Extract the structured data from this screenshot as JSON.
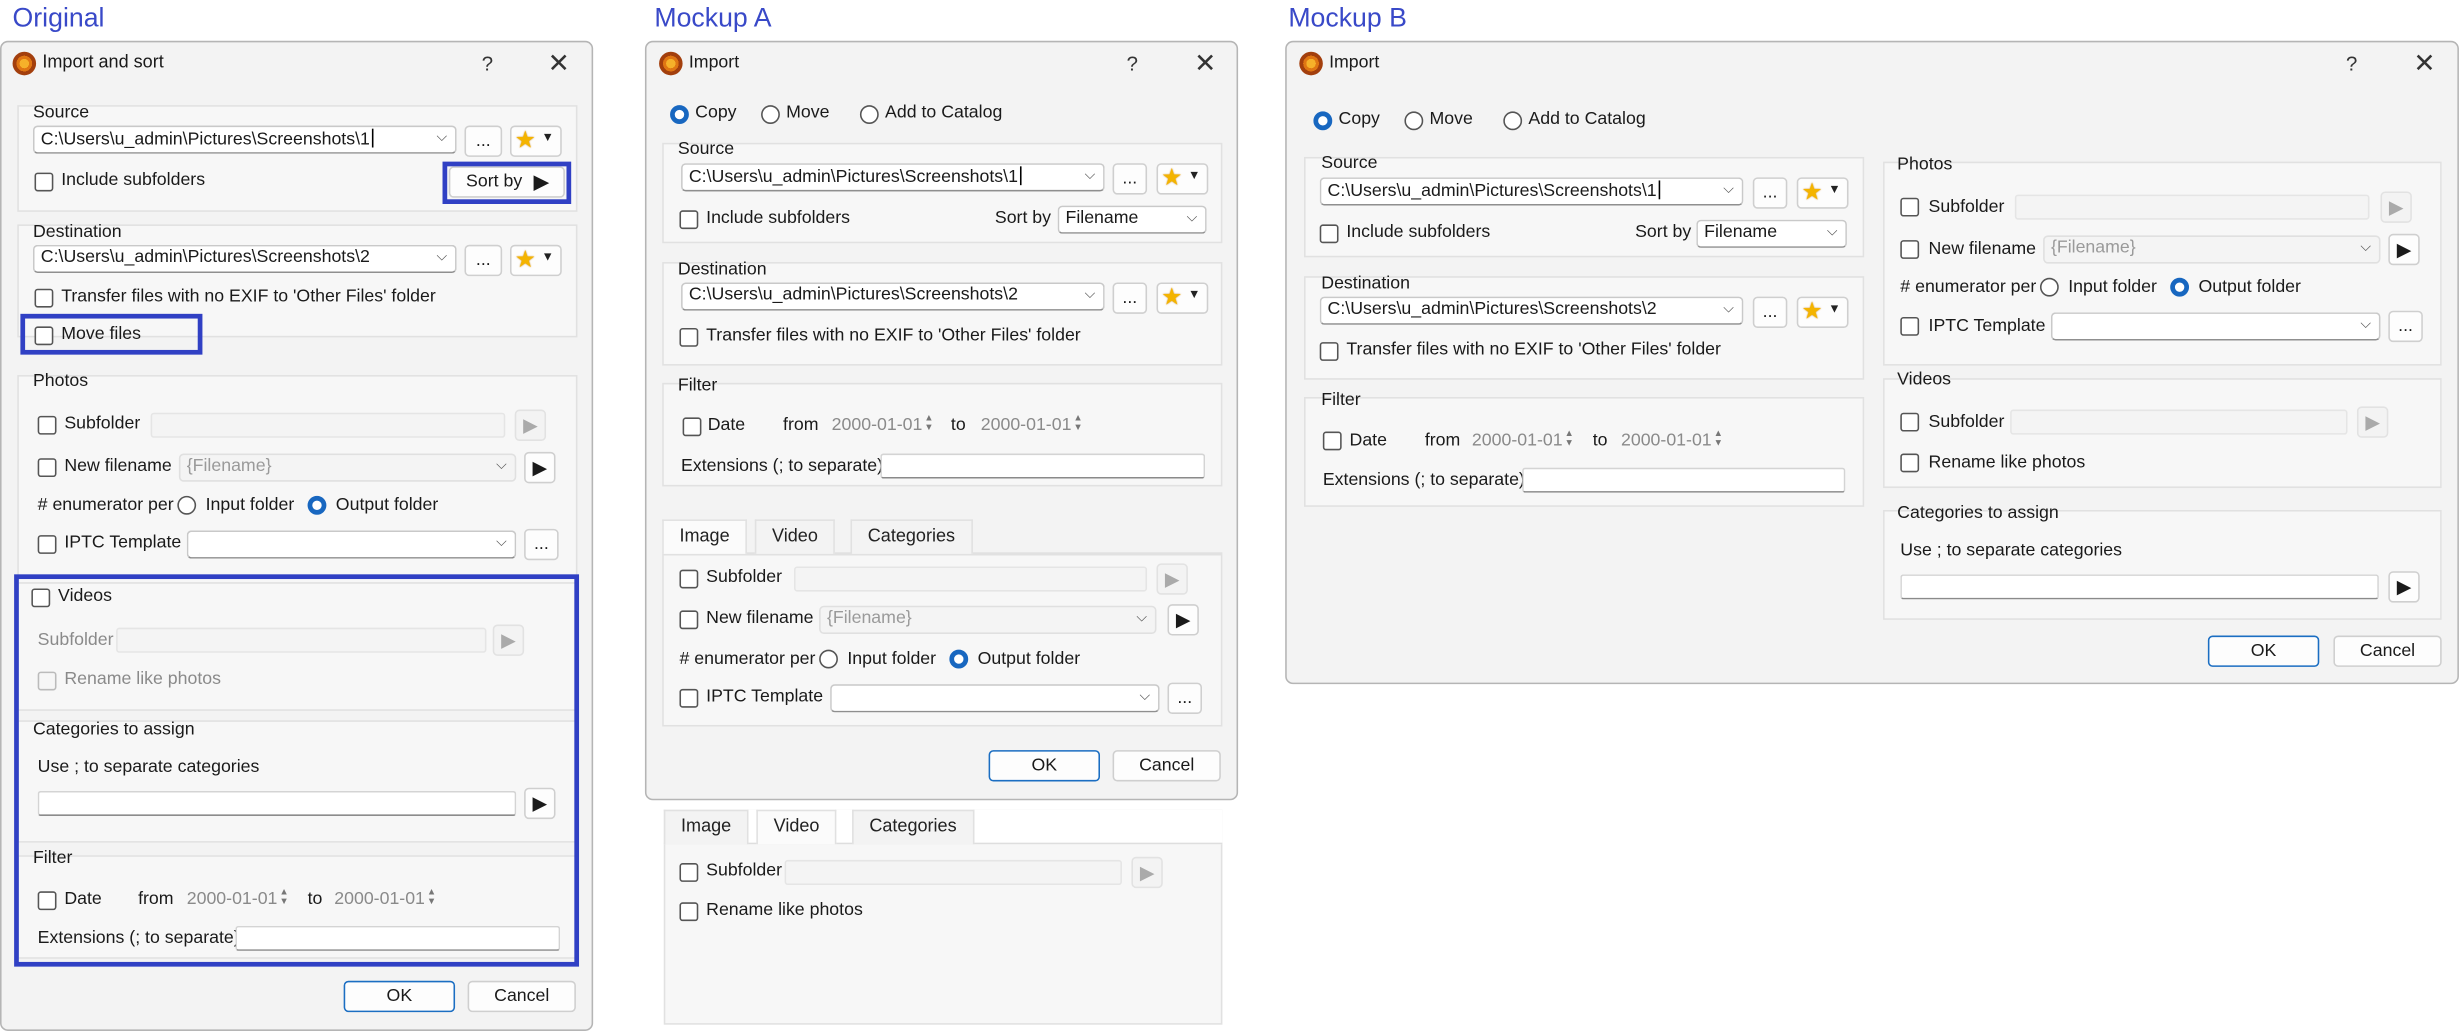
{
  "headings": {
    "original": "Original",
    "mockup_a": "Mockup A",
    "mockup_b": "Mockup B"
  },
  "common": {
    "help": "?",
    "close": "✕",
    "browse": "...",
    "source": "Source",
    "destination": "Destination",
    "source_path": "C:\\Users\\u_admin\\Pictures\\Screenshots\\1",
    "destination_path": "C:\\Users\\u_admin\\Pictures\\Screenshots\\2",
    "include_subfolders": "Include subfolders",
    "transfer_no_exif": "Transfer files with no EXIF to 'Other Files' folder",
    "photos": "Photos",
    "videos": "Videos",
    "subfolder": "Subfolder",
    "new_filename": "New filename",
    "filename_placeholder": "{Filename}",
    "enumerator_per": "# enumerator per",
    "input_folder": "Input folder",
    "output_folder": "Output folder",
    "iptc_template": "IPTC Template",
    "rename_like_photos": "Rename like photos",
    "categories_to_assign": "Categories to assign",
    "use_separate": "Use ; to separate categories",
    "filter": "Filter",
    "date": "Date",
    "from": "from",
    "to": "to",
    "date_from": "2000-01-01",
    "date_to": "2000-01-01",
    "extensions": "Extensions (; to separate)",
    "ok": "OK",
    "cancel": "Cancel",
    "copy": "Copy",
    "move": "Move",
    "add_to_catalog": "Add to Catalog",
    "sort_by": "Sort by",
    "sort_value": "Filename",
    "move_files": "Move files",
    "tab_image": "Image",
    "tab_video": "Video",
    "tab_categories": "Categories"
  },
  "original": {
    "title": "Import and sort"
  },
  "mockup_a": {
    "title": "Import"
  },
  "mockup_b": {
    "title": "Import"
  },
  "colors": {
    "highlight": "#3040c4",
    "heading": "#3949c8",
    "radio_selected": "#1867c0",
    "star": "#f4b400"
  }
}
